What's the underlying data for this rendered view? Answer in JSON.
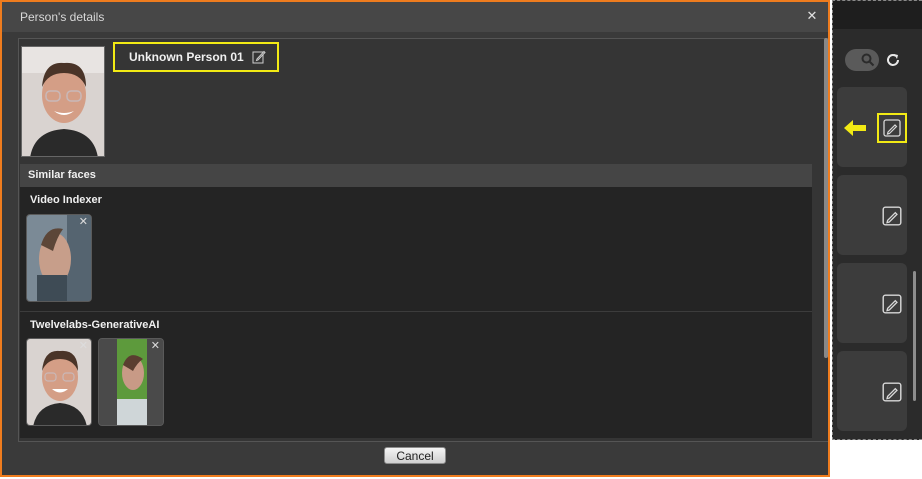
{
  "dialog": {
    "title": "Person's details",
    "close_icon": "close-icon",
    "person_name": "Unknown Person 01",
    "edit_icon": "pencil-edit-icon",
    "similar_header": "Similar faces",
    "groups": [
      {
        "title": "Video Indexer",
        "thumbnails": 1
      },
      {
        "title": "Twelvelabs-GenerativeAI",
        "thumbnails": 2
      }
    ],
    "cancel_label": "Cancel"
  },
  "background_panel": {
    "search_icon": "search-icon",
    "refresh_icon": "refresh-icon",
    "card_icon": "tag-edit-icon",
    "arrow_icon": "arrow-left-icon"
  },
  "colors": {
    "dialog_border": "#ef7c1e",
    "highlight": "#f2ea14",
    "dialog_bg": "#3a3a3a",
    "section_bg": "#242424"
  }
}
